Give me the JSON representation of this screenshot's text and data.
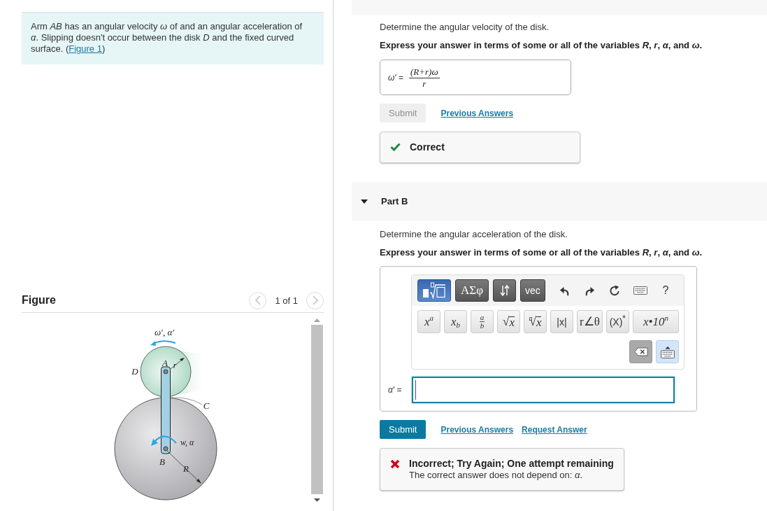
{
  "problem": {
    "text": "Arm *AB* has an angular velocity *ω* of and an angular acceleration of *α*. Slipping doesn't occur between the disk *D* and the fixed curved surface.",
    "link_prefix": "(",
    "link": "Figure 1",
    "link_suffix": ")"
  },
  "figure": {
    "title": "Figure",
    "pager": {
      "previous_disabled": true,
      "text": "1 of 1",
      "next_disabled": true
    },
    "labels": {
      "disk_motion": "ω′, α′",
      "point_a": "A",
      "small_radius": "r",
      "disk": "D",
      "surface": "C",
      "arm_motion": "w, α",
      "point_b": "B",
      "large_radius": "R"
    }
  },
  "part_a": {
    "prompt": "Determine the angular velocity of the disk.",
    "instruction": "Express your answer in terms of some or all of the variables *R*, *r*, *α*, and *ω*.",
    "answer": {
      "label": "*ω′* =",
      "numerator": "(R+r)ω",
      "denominator": "r"
    },
    "submit": {
      "label": "Submit",
      "disabled": true
    },
    "links": [
      "Previous Answers"
    ],
    "feedback": {
      "kind": "correct",
      "title": "Correct"
    }
  },
  "part_b": {
    "title": "Part B",
    "expanded": true,
    "prompt": "Determine the angular acceleration of the disk.",
    "instruction": "Express your answer in terms of some or all of the variables *R*, *r*, *α*, and *ω*.",
    "toolbar": {
      "tabs": [
        {
          "kind": "template",
          "selected": true
        },
        {
          "kind": "symbols",
          "label": "ΑΣφ",
          "selected": false
        },
        {
          "kind": "arrows",
          "selected": false
        },
        {
          "kind": "text",
          "label": "vec",
          "selected": false
        }
      ],
      "tools": [
        {
          "kind": "undo"
        },
        {
          "kind": "redo"
        },
        {
          "kind": "reset"
        },
        {
          "kind": "keyboard"
        },
        {
          "kind": "help",
          "label": "?"
        }
      ],
      "keys": [
        {
          "kind": "math",
          "label": "x$^{a}$"
        },
        {
          "kind": "math",
          "label": "x$_{b}$"
        },
        {
          "kind": "fraction",
          "numerator": "a",
          "denominator": "b"
        },
        {
          "kind": "root",
          "sign": "√",
          "radicand": "x"
        },
        {
          "kind": "root",
          "index": "n",
          "sign": "√",
          "radicand": "x"
        },
        {
          "kind": "plain",
          "label": "|x|"
        },
        {
          "kind": "symbol",
          "label": "r∠θ"
        },
        {
          "kind": "plain",
          "label": "(X)$^{*}$"
        },
        {
          "kind": "math",
          "label": "x•10$^{n}$"
        }
      ],
      "edit_keys": [
        {
          "kind": "backspace"
        },
        {
          "kind": "keyboard"
        }
      ]
    },
    "answer": {
      "label": "*α′* =",
      "focused": true
    },
    "submit": {
      "label": "Submit",
      "disabled": false
    },
    "links": [
      "Previous Answers",
      "Request Answer"
    ],
    "feedback": {
      "kind": "incorrect",
      "title": "Incorrect; Try Again; One attempt remaining",
      "detail": "The correct answer does not depend on: *α*."
    }
  }
}
